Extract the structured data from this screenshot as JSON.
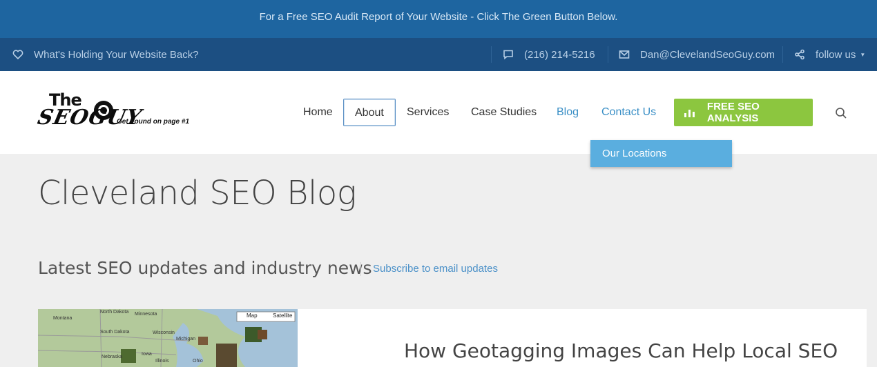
{
  "announcement": {
    "text": "For a Free SEO Audit Report of Your Website - Click The Green Button Below."
  },
  "topbar": {
    "left_link": "What's Holding Your Website Back?",
    "phone": "(216) 214-5216",
    "email": "Dan@ClevelandSeoGuy.com",
    "follow": "follow us"
  },
  "logo": {
    "word_the": "The",
    "word_seoguy": "SEOGUY",
    "tagline": "Get Found on page #1"
  },
  "nav": {
    "items": [
      {
        "label": "Home"
      },
      {
        "label": "About"
      },
      {
        "label": "Services"
      },
      {
        "label": "Case Studies"
      },
      {
        "label": "Blog"
      },
      {
        "label": "Contact Us"
      }
    ],
    "cta_label": "FREE SEO ANALYSIS",
    "dropdown_item": "Our Locations"
  },
  "page": {
    "title": "Cleveland SEO Blog",
    "subtitle": "Latest SEO updates and industry news",
    "subscribe": "Subscribe to email updates"
  },
  "post": {
    "title": "How Geotagging Images Can Help Local SEO",
    "map_labels": [
      "North Dakota",
      "Montana",
      "South Dakota",
      "Minnesota",
      "Wisconsin",
      "Michigan",
      "Nebraska",
      "Iowa",
      "Illinois",
      "Ohio",
      "Map",
      "Satellite"
    ]
  },
  "colors": {
    "announce_bg": "#1e65a0",
    "topbar_bg": "#1c4f82",
    "cta_green": "#8cc63f",
    "dropdown_blue": "#5aaedf",
    "link_blue": "#3a8fc6"
  },
  "icons": {
    "heart": "heart-icon",
    "phone": "chat-bubble-icon",
    "email": "envelope-icon",
    "follow": "share-icon",
    "search": "search-icon",
    "cta": "bar-chart-icon"
  }
}
